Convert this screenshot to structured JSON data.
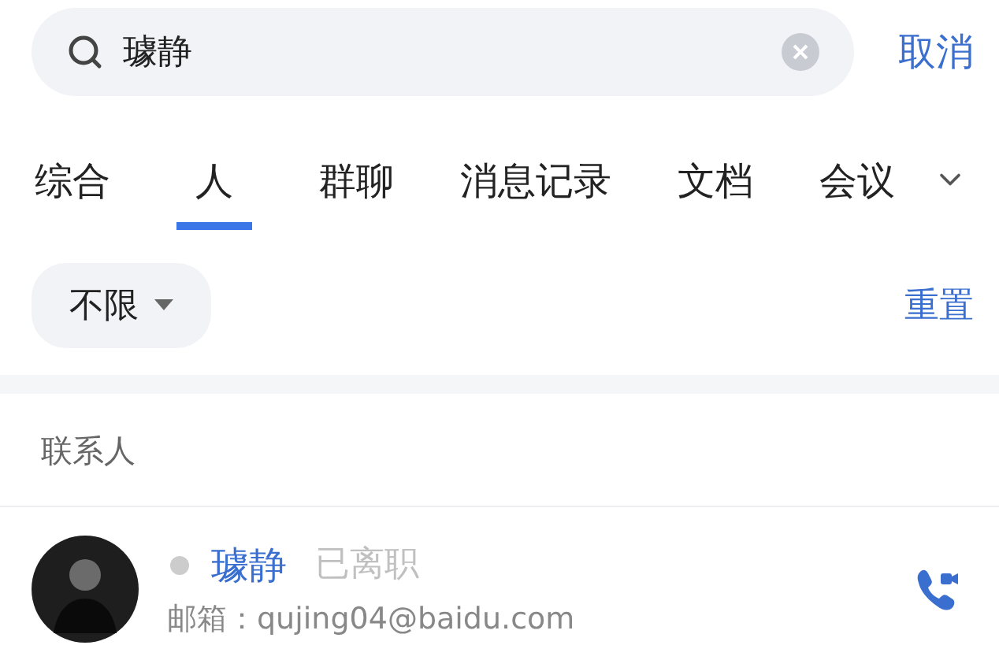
{
  "search": {
    "value": "璩静",
    "cancel": "取消"
  },
  "tabs": [
    {
      "label": "综合",
      "selected": false
    },
    {
      "label": "人",
      "selected": true
    },
    {
      "label": "群聊",
      "selected": false
    },
    {
      "label": "消息记录",
      "selected": false
    },
    {
      "label": "文档",
      "selected": false
    },
    {
      "label": "会议",
      "selected": false
    }
  ],
  "filter": {
    "label": "不限",
    "reset": "重置"
  },
  "section": {
    "title": "联系人"
  },
  "contacts": [
    {
      "name": "璩静",
      "online": false,
      "status": "已离职",
      "email": "邮箱：qujing04@baidu.com"
    }
  ]
}
